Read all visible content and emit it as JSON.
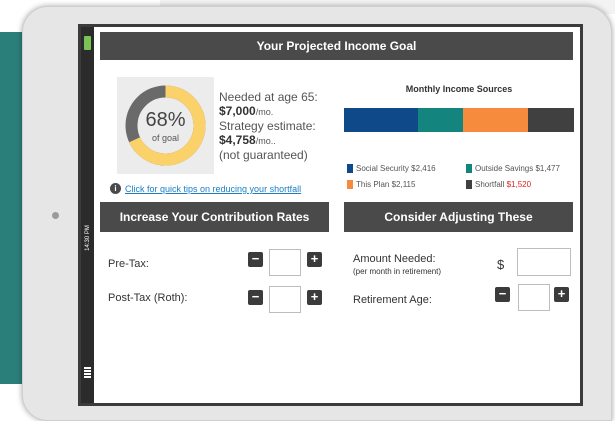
{
  "status": {
    "time": "14:30 PM"
  },
  "goal": {
    "title": "Your Projected Income Goal",
    "percent": "68%",
    "percent_value": 68,
    "percent_sub": "of goal",
    "needed_label": "Needed at age 65:",
    "needed_value": "$7,000",
    "needed_unit": "/mo.",
    "strategy_label": "Strategy estimate:",
    "strategy_value": "$4,758",
    "strategy_unit": "/mo..",
    "not_guaranteed": "(not guaranteed)",
    "colors": {
      "progress": "#fbd16a",
      "remainder": "#6a6a6a"
    }
  },
  "income": {
    "title": "Monthly Income Sources",
    "segments": [
      {
        "name": "Social Security",
        "label": "Social Security $2,416",
        "value": 2416,
        "color": "#10498a"
      },
      {
        "name": "Outside Savings",
        "label": "Outside Savings $1,477",
        "value": 1477,
        "color": "#14857e"
      },
      {
        "name": "This Plan",
        "label": "This Plan $2,115",
        "value": 2115,
        "color": "#f68a3d"
      },
      {
        "name": "Shortfall",
        "label": "Shortfall",
        "amount": "$1,520",
        "value": 1520,
        "color": "#404040",
        "amount_color": "#e02020"
      }
    ]
  },
  "tips": {
    "link": "Click for quick tips on reducing your shortfall",
    "icon": "info-icon"
  },
  "contribution": {
    "title": "Increase Your Contribution Rates",
    "pretax_label": "Pre-Tax:",
    "posttax_label": "Post-Tax (Roth):",
    "minus": "−",
    "plus": "+"
  },
  "adjust": {
    "title": "Consider Adjusting These",
    "amount_label": "Amount Needed:",
    "amount_sub": "(per month in retirement)",
    "currency": "$",
    "age_label": "Retirement Age:",
    "minus": "−",
    "plus": "+"
  }
}
